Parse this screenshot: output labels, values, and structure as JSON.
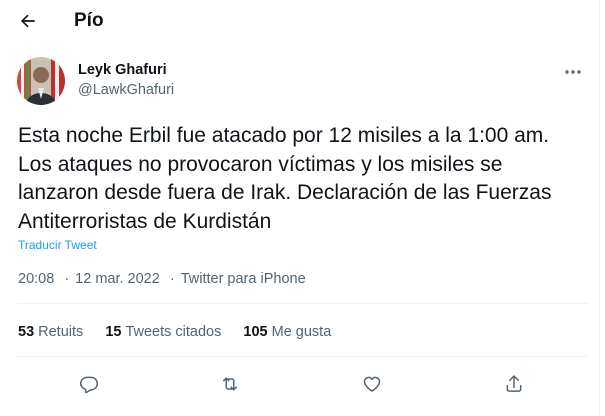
{
  "header": {
    "title": "Pío"
  },
  "tweet": {
    "author_name": "Leyk Ghafuri",
    "author_handle": "@LawkGhafuri",
    "text": "Esta noche Erbil fue atacado por 12 misiles a la 1:00 am. Los ataques no provocaron víctimas y los misiles se lanzaron desde fuera de Irak. Declaración de las Fuerzas Antiterroristas de Kurdistán",
    "translate_label": "Traducir Tweet",
    "time": "20:08",
    "date": "12 mar. 2022",
    "source": "Twitter para iPhone",
    "separator": "·"
  },
  "stats": {
    "retweets_count": "53",
    "retweets_label": "Retuits",
    "quotes_count": "15",
    "quotes_label": "Tweets citados",
    "likes_count": "105",
    "likes_label": "Me gusta"
  },
  "icons": {
    "back": "arrow-left-icon",
    "more": "more-horizontal-icon",
    "reply": "reply-icon",
    "retweet": "retweet-icon",
    "like": "heart-icon",
    "share": "share-icon"
  },
  "colors": {
    "link": "#1d9bf0",
    "text": "#0f1419",
    "secondary": "#536471",
    "divider": "#eff3f4"
  }
}
